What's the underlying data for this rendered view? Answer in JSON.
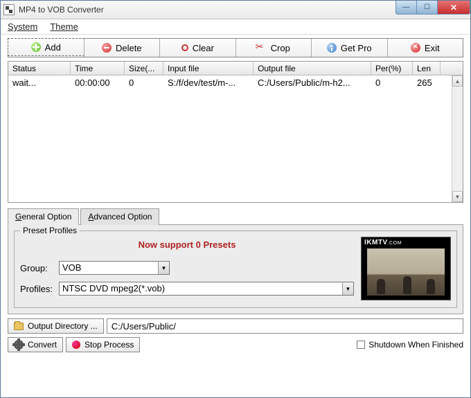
{
  "title": "MP4 to VOB Converter",
  "menu": {
    "system": "System",
    "theme": "Theme"
  },
  "toolbar": {
    "add": "Add",
    "delete": "Delete",
    "clear": "Clear",
    "crop": "Crop",
    "getpro": "Get Pro",
    "exit": "Exit"
  },
  "columns": {
    "status": "Status",
    "time": "Time",
    "size": "Size(...",
    "input": "Input file",
    "output": "Output file",
    "per": "Per(%)",
    "len": "Len"
  },
  "rows": [
    {
      "status": "wait...",
      "time": "00:00:00",
      "size": "0",
      "input": "S:/f/dev/test/m-...",
      "output": "C:/Users/Public/m-h2...",
      "per": "0",
      "len": "265"
    }
  ],
  "tabs": {
    "general": "General Option",
    "advanced": "Advanced Option"
  },
  "preset": {
    "legend": "Preset Profiles",
    "message": "Now support 0 Presets",
    "group_label": "Group:",
    "group_value": "VOB",
    "profiles_label": "Profiles:",
    "profiles_value": "NTSC DVD mpeg2(*.vob)",
    "watermark": "IKMTV",
    "watermark_suffix": ".COM"
  },
  "output": {
    "button": "Output Directory ...",
    "path": "C:/Users/Public/"
  },
  "bottom": {
    "convert": "Convert",
    "stop": "Stop Process",
    "shutdown": "Shutdown When Finished"
  }
}
